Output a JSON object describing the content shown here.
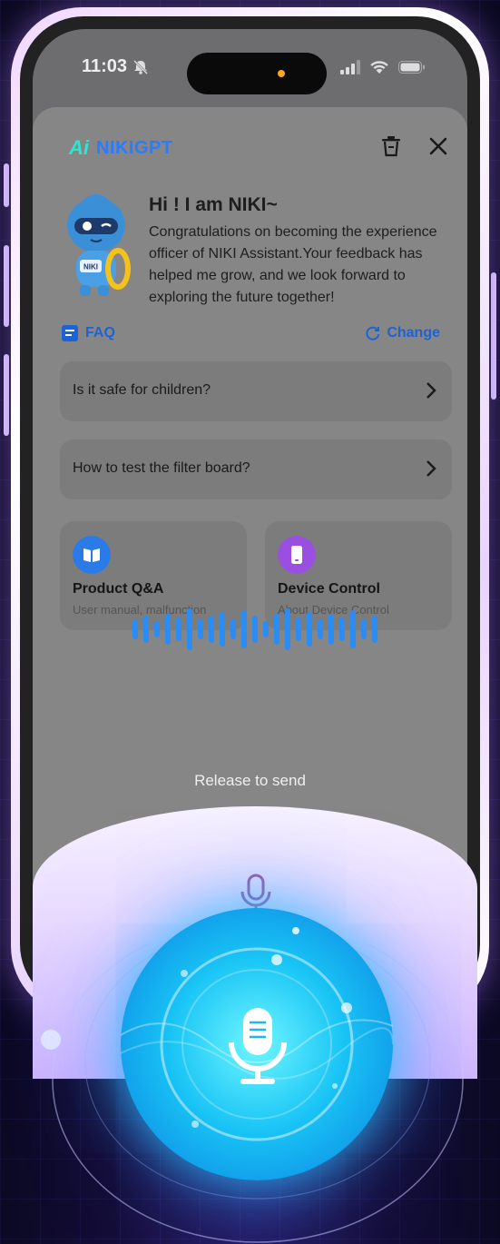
{
  "status_bar": {
    "time": "11:03",
    "icons": [
      "bell-slash-icon",
      "cellular-signal-icon",
      "wifi-icon",
      "battery-icon"
    ]
  },
  "header": {
    "brand_mark": "Ai",
    "brand_name": "NIKIGPT",
    "actions": [
      "trash-icon",
      "close-icon"
    ]
  },
  "greeting": {
    "mascot_badge": "NIKI",
    "title": "Hi ! I am NIKI~",
    "text": "Congratulations on becoming the experience officer of NIKI Assistant.Your feedback has helped me grow, and we look forward to exploring the future together!"
  },
  "faq": {
    "label": "FAQ",
    "change_label": "Change",
    "questions": [
      "Is it safe for children?",
      "How to test the filter board?"
    ]
  },
  "cards": [
    {
      "title": "Product Q&A",
      "subtitle": "User manual, malfunction",
      "icon": "book-icon",
      "color": "#2a7be8"
    },
    {
      "title": "Device Control",
      "subtitle": "About Device Control",
      "icon": "phone-device-icon",
      "color": "#9a4fe0"
    }
  ],
  "voice": {
    "release_hint": "Release to send",
    "accent": "#1ab8f5",
    "icons": [
      "waveform-icon",
      "microphone-icon"
    ]
  },
  "colors": {
    "brand": "#2b7bff",
    "link": "#1e63d6",
    "glow": "#19c4f5"
  }
}
